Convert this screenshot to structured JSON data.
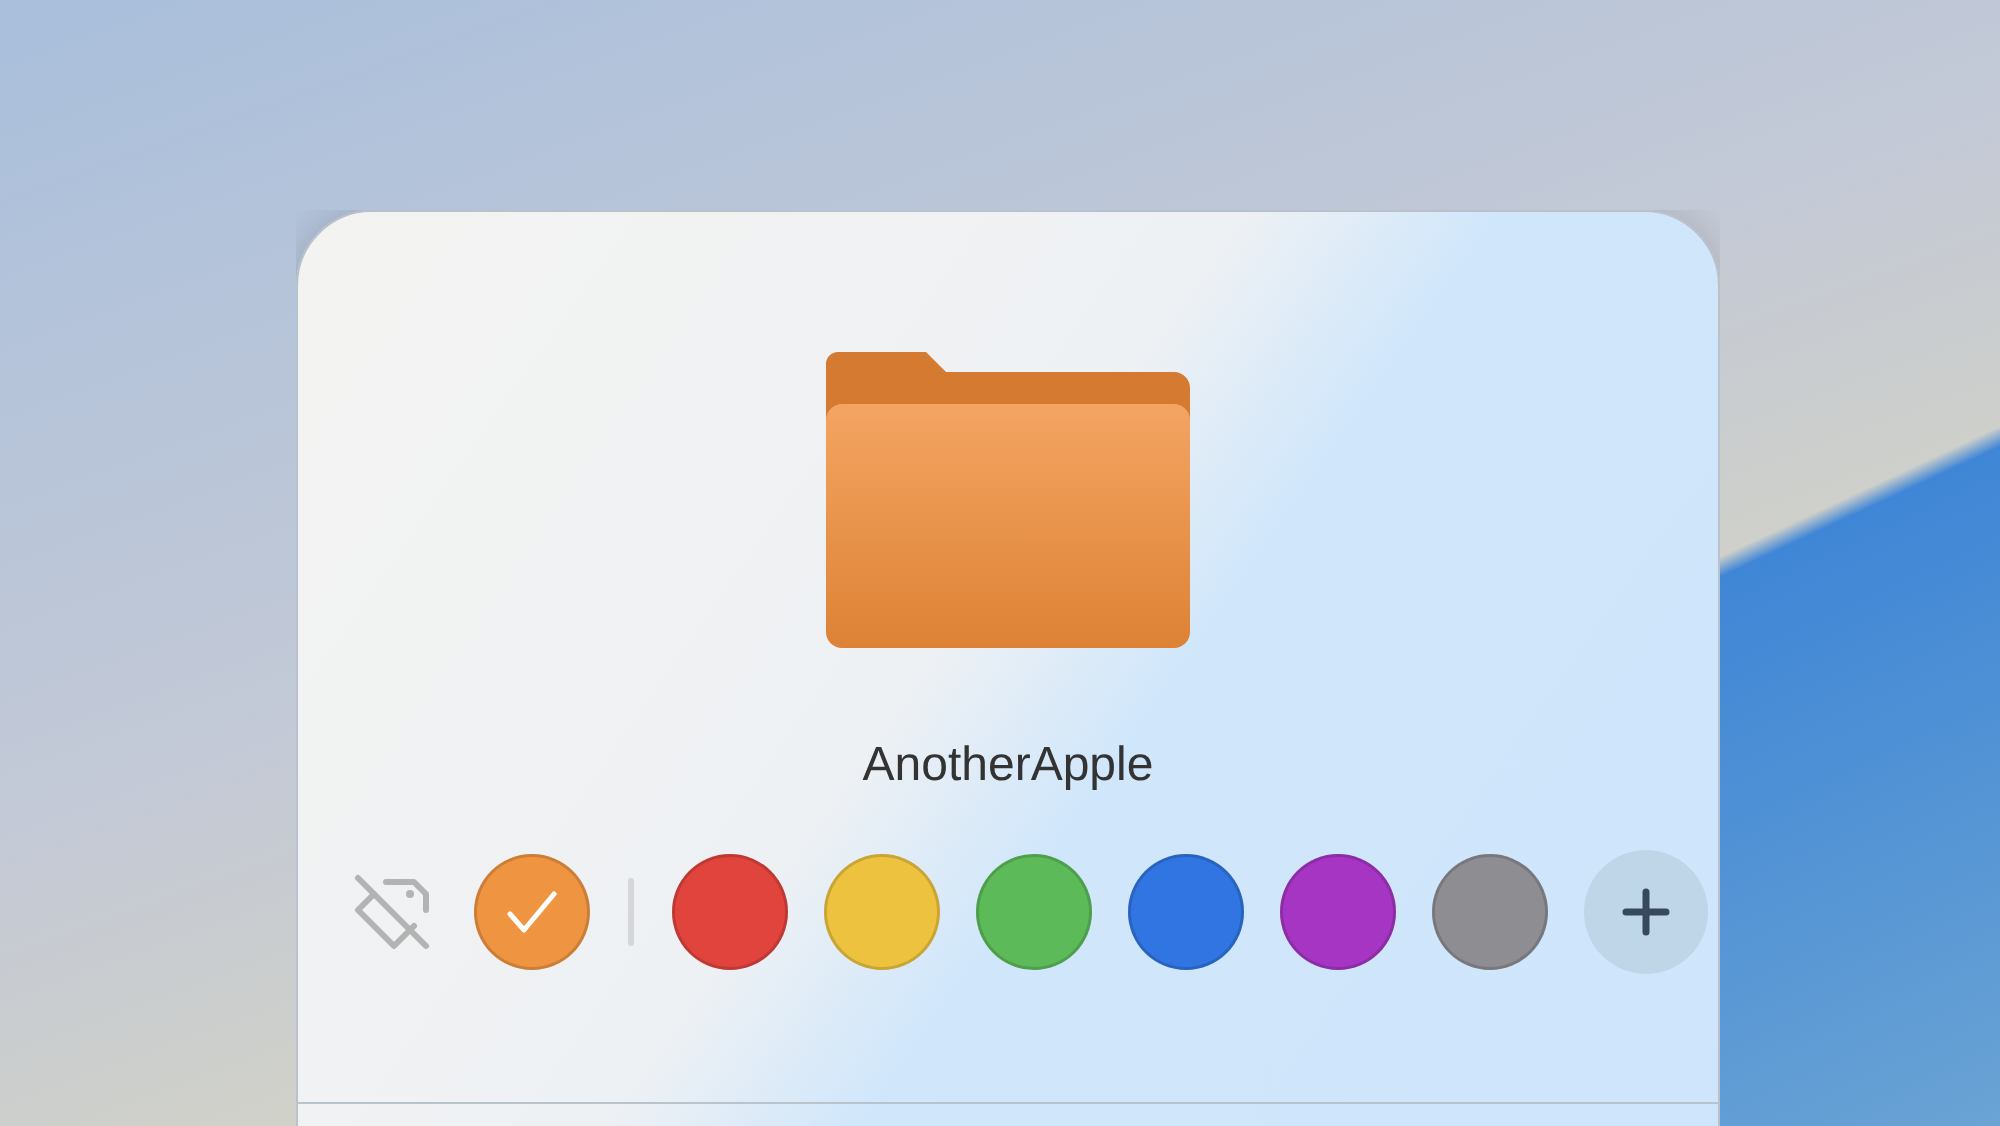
{
  "file": {
    "name": "AnotherApple"
  },
  "tags": [
    {
      "color": "#ef9440",
      "selected": true
    },
    {
      "color": "#e0443c",
      "selected": false
    },
    {
      "color": "#ecc23f",
      "selected": false
    },
    {
      "color": "#5cba59",
      "selected": false
    },
    {
      "color": "#3175e2",
      "selected": false
    },
    {
      "color": "#a535c2",
      "selected": false
    },
    {
      "color": "#8e8d92",
      "selected": false
    }
  ]
}
